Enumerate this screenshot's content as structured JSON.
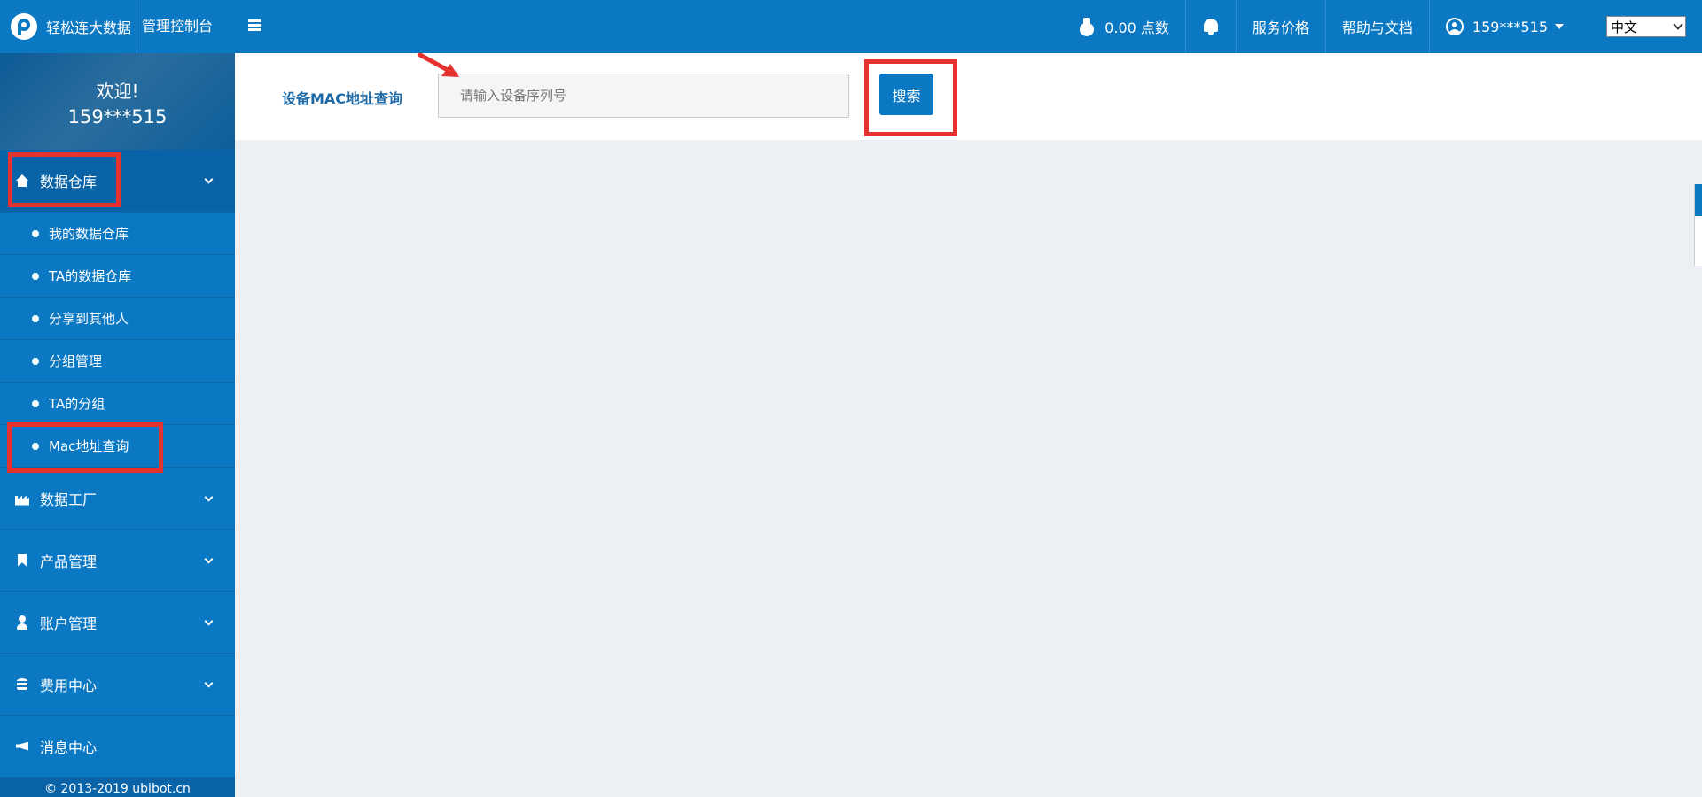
{
  "header": {
    "brand_name": "轻松连大数据",
    "console_label": "管理控制台",
    "points": "0.00 点数",
    "pricing": "服务价格",
    "help": "帮助与文档",
    "user": "159***515",
    "language": "中文"
  },
  "sidebar": {
    "welcome": "欢迎!",
    "user": "159***515",
    "groups": [
      {
        "label": "数据仓库",
        "icon": "home-icon"
      },
      {
        "label": "数据工厂",
        "icon": "factory-icon"
      },
      {
        "label": "产品管理",
        "icon": "bookmark-icon"
      },
      {
        "label": "账户管理",
        "icon": "person-icon"
      },
      {
        "label": "费用中心",
        "icon": "database-icon"
      },
      {
        "label": "消息中心",
        "icon": "megaphone-icon"
      }
    ],
    "children": [
      "我的数据仓库",
      "TA的数据仓库",
      "分享到其他人",
      "分组管理",
      "TA的分组",
      "Mac地址查询"
    ],
    "copyright": "© 2013-2019 ubibot.cn"
  },
  "search": {
    "label": "设备MAC地址查询",
    "placeholder": "请输入设备序列号",
    "value": "",
    "button": "搜索"
  },
  "colors": {
    "primary": "#0a78c3",
    "sidebar_dark": "#0963a6",
    "annotation": "#e6322e",
    "background": "#ecf0f5"
  }
}
